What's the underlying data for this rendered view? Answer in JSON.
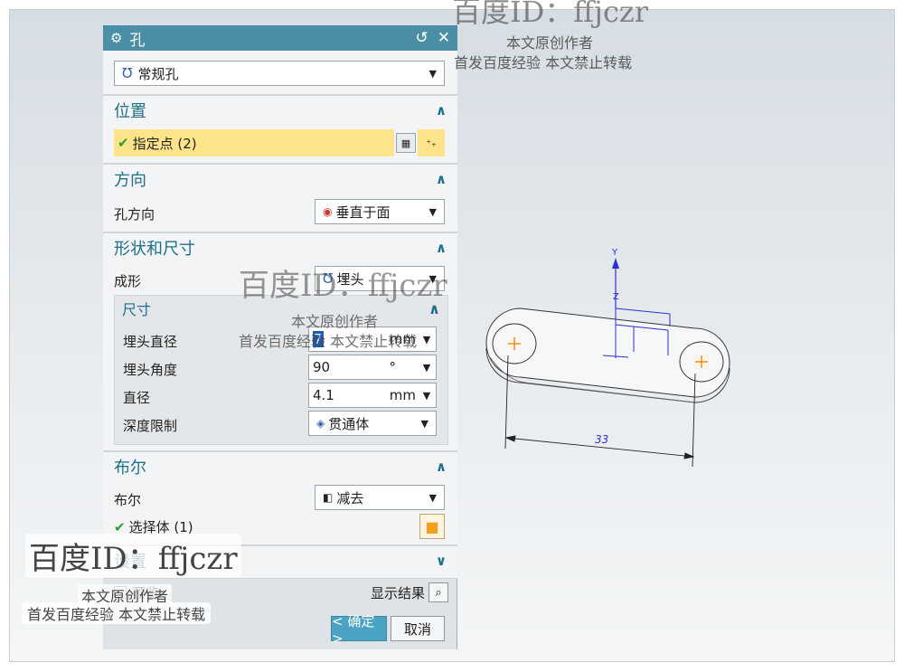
{
  "dialog": {
    "title": "孔",
    "reset_icon": "↺",
    "close_icon": "✕",
    "type_select": "常规孔"
  },
  "position": {
    "header": "位置",
    "specify_point": "指定点 (2)"
  },
  "direction": {
    "header": "方向",
    "hole_direction_label": "孔方向",
    "hole_direction_value": "垂直于面"
  },
  "shape": {
    "header": "形状和尺寸",
    "form_label": "成形",
    "form_value": "埋头",
    "dims_header": "尺寸",
    "cs_diameter_label": "埋头直径",
    "cs_diameter_value": "7",
    "cs_diameter_unit": "mm",
    "cs_angle_label": "埋头角度",
    "cs_angle_value": "90",
    "cs_angle_unit": "°",
    "diameter_label": "直径",
    "diameter_value": "4.1",
    "diameter_unit": "mm",
    "depth_label": "深度限制",
    "depth_value": "贯通体"
  },
  "boolean": {
    "header": "布尔",
    "label": "布尔",
    "value": "减去",
    "select_body": "选择体 (1)"
  },
  "settings": {
    "header": "设置",
    "preview_label": "预览",
    "show_result": "显示结果"
  },
  "buttons": {
    "ok": "< 确定 >",
    "cancel": "取消"
  },
  "viewport": {
    "dimension": "33",
    "axis_y": "Y",
    "axis_z": "Z"
  },
  "watermarks": {
    "id": "百度ID：ffjczr",
    "line1": "本文原创作者",
    "line2": "首发百度经验  本文禁止转载"
  }
}
